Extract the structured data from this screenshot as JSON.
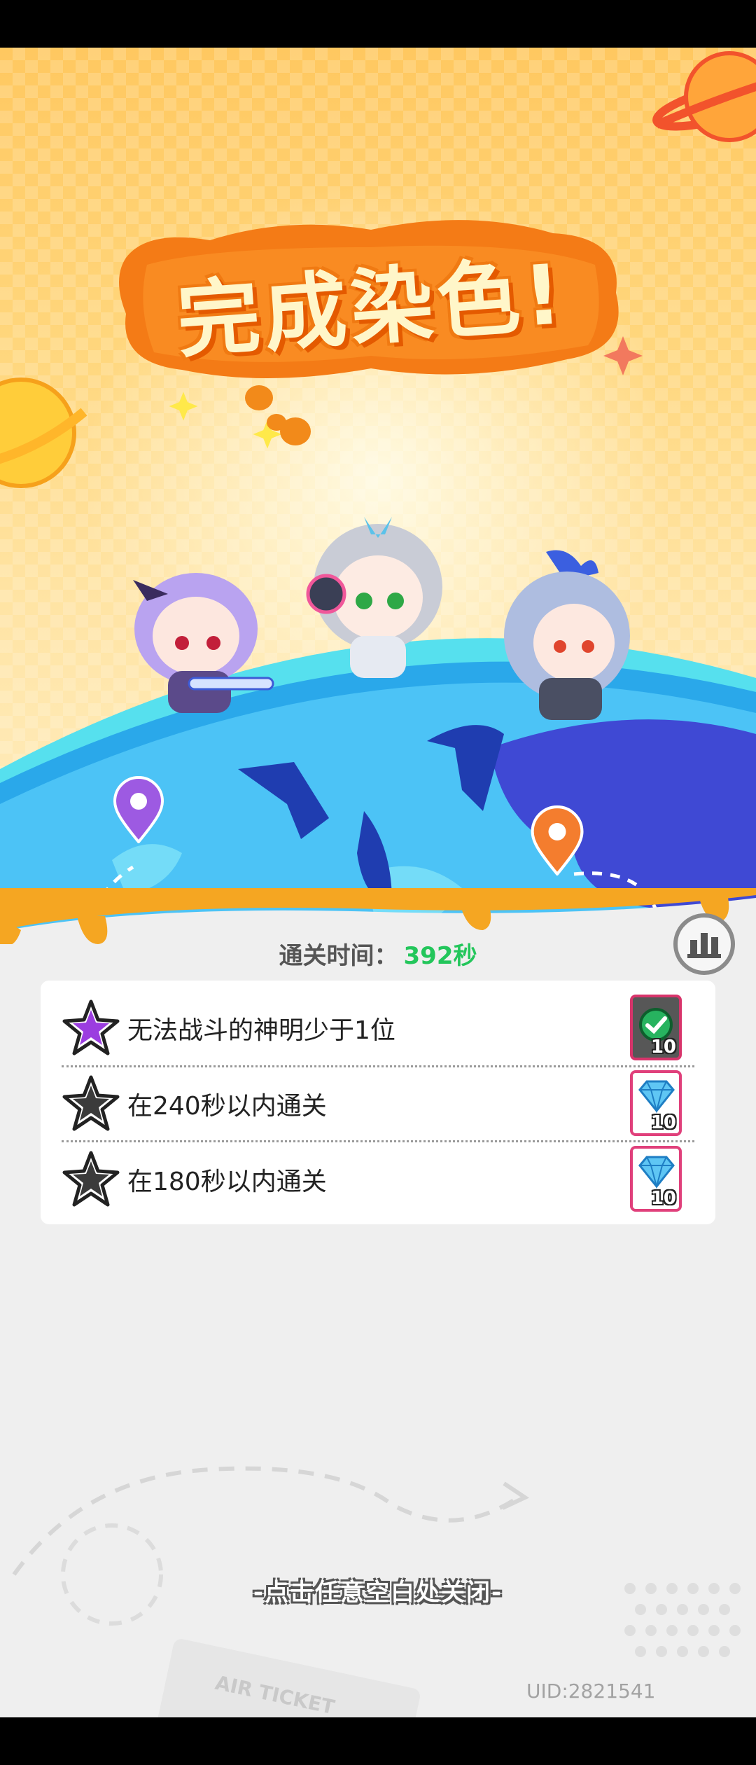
{
  "result": {
    "title": "完成染色!",
    "clear_time_label": "通关时间：",
    "clear_time_value": "392秒"
  },
  "objectives": [
    {
      "text": "无法战斗的神明少于1位",
      "achieved": true,
      "reward_icon": "checkmark-reward-icon",
      "reward_count": "10"
    },
    {
      "text": "在240秒以内通关",
      "achieved": false,
      "reward_icon": "diamond-icon",
      "reward_count": "10"
    },
    {
      "text": "在180秒以内通关",
      "achieved": false,
      "reward_icon": "diamond-icon",
      "reward_count": "10"
    }
  ],
  "footer": {
    "close_hint": "-点击任意空白处关闭-",
    "uid": "UID:2821541",
    "ticket_text": "AIR TICKET"
  },
  "colors": {
    "accent_orange": "#f47b16",
    "time_green": "#23c65b",
    "star_achieved": "#9b3de0",
    "star_empty": "#3b3b3b",
    "reward_border": "#e0407b"
  }
}
